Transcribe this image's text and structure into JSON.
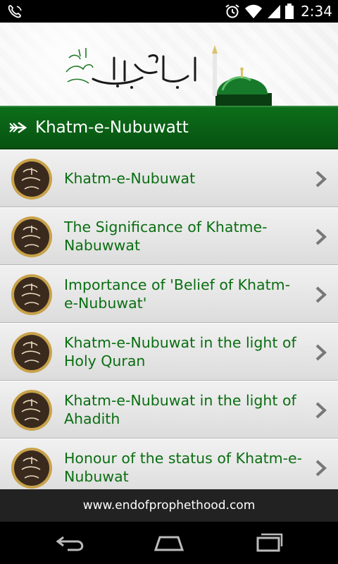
{
  "status_bar": {
    "time": "2:34"
  },
  "title_bar": {
    "title": "Khatm-e-Nubuwatt"
  },
  "list": {
    "items": [
      {
        "label": "Khatm-e-Nubuwat"
      },
      {
        "label": "The Significance of Khatme-Nabuwwat"
      },
      {
        "label": "Importance of 'Belief of Khatm-e-Nubuwat'"
      },
      {
        "label": "Khatm-e-Nubuwat in the light of Holy Quran"
      },
      {
        "label": "Khatm-e-Nubuwat in the light of Ahadith"
      },
      {
        "label": "Honour of the status of Khatm-e-Nubuwat"
      }
    ]
  },
  "footer": {
    "website": "www.endofprophethood.com"
  },
  "icons": {
    "status": [
      "phone-icon",
      "alarm-icon",
      "wifi-icon",
      "signal-icon",
      "battery-icon"
    ],
    "title": "arrow-icon",
    "list_item": "seal-icon",
    "chevron": "chevron-right-icon",
    "nav": [
      "back-icon",
      "home-icon",
      "recents-icon"
    ]
  },
  "colors": {
    "title_bar": "#075311",
    "item_text": "#0a6e12",
    "footer": "#222222"
  }
}
